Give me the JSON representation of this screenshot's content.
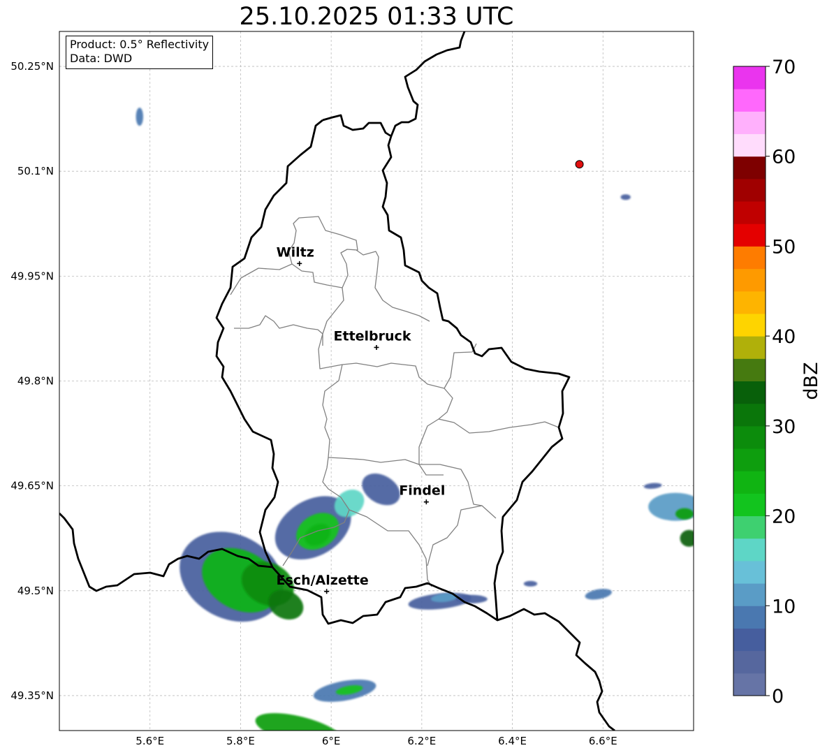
{
  "title": "25.10.2025 01:33 UTC",
  "info": {
    "product": "Product: 0.5° Reflectivity",
    "source": "Data: DWD"
  },
  "map": {
    "lon_range": [
      5.4,
      6.8
    ],
    "lat_range": [
      49.3,
      50.3
    ],
    "lat_ticks": [
      {
        "value": 50.25,
        "label": "50.25°N"
      },
      {
        "value": 50.1,
        "label": "50.1°N"
      },
      {
        "value": 49.95,
        "label": "49.95°N"
      },
      {
        "value": 49.8,
        "label": "49.8°N"
      },
      {
        "value": 49.65,
        "label": "49.65°N"
      },
      {
        "value": 49.5,
        "label": "49.5°N"
      },
      {
        "value": 49.35,
        "label": "49.35°N"
      }
    ],
    "lon_ticks": [
      {
        "value": 5.6,
        "label": "5.6°E"
      },
      {
        "value": 5.8,
        "label": "5.8°E"
      },
      {
        "value": 6.0,
        "label": "6°E"
      },
      {
        "value": 6.2,
        "label": "6.2°E"
      },
      {
        "value": 6.4,
        "label": "6.4°E"
      },
      {
        "value": 6.6,
        "label": "6.6°E"
      }
    ],
    "cities": [
      {
        "name": "Wiltz",
        "lon": 5.93,
        "lat": 49.968
      },
      {
        "name": "Ettelbruck",
        "lon": 6.1,
        "lat": 49.848
      },
      {
        "name": "Findel",
        "lon": 6.21,
        "lat": 49.627
      },
      {
        "name": "Esch/Alzette",
        "lon": 5.99,
        "lat": 49.499
      }
    ],
    "radar_site": {
      "lon": 6.548,
      "lat": 50.11,
      "color": "#e11010"
    },
    "border_color": "#000000",
    "canton_color": "#808080",
    "grid": true
  },
  "colorbar": {
    "label": "dBZ",
    "min": 0,
    "max": 70,
    "step": 2.5,
    "ticks": [
      {
        "value": 0,
        "label": "0"
      },
      {
        "value": 10,
        "label": "10"
      },
      {
        "value": 20,
        "label": "20"
      },
      {
        "value": 30,
        "label": "30"
      },
      {
        "value": 40,
        "label": "40"
      },
      {
        "value": 50,
        "label": "50"
      },
      {
        "value": 60,
        "label": "60"
      },
      {
        "value": 70,
        "label": "70"
      }
    ],
    "colors": [
      "#6674a6",
      "#56679e",
      "#465e9e",
      "#4a78b0",
      "#5a9cc6",
      "#68c0d8",
      "#5ed6c6",
      "#3ed070",
      "#12c41e",
      "#10b412",
      "#0e9e0e",
      "#0c8c0c",
      "#0a760a",
      "#08600a",
      "#467a10",
      "#b0b00a",
      "#fed400",
      "#feb400",
      "#fe9a00",
      "#fe7c00",
      "#e40000",
      "#c00000",
      "#a00000",
      "#7e0000",
      "#ffdcfc",
      "#ffb0fc",
      "#ff68fc",
      "#ea34ee"
    ]
  },
  "radar_echoes": [
    {
      "lon": 5.78,
      "lat": 49.52,
      "rx": 0.12,
      "ry": 0.06,
      "rot": 28,
      "dbz": 6
    },
    {
      "lon": 5.8,
      "lat": 49.515,
      "rx": 0.09,
      "ry": 0.042,
      "rot": 28,
      "dbz": 24
    },
    {
      "lon": 5.86,
      "lat": 49.51,
      "rx": 0.06,
      "ry": 0.03,
      "rot": 25,
      "dbz": 29
    },
    {
      "lon": 5.9,
      "lat": 49.48,
      "rx": 0.04,
      "ry": 0.02,
      "rot": 25,
      "dbz": 31
    },
    {
      "lon": 5.96,
      "lat": 49.59,
      "rx": 0.09,
      "ry": 0.04,
      "rot": -30,
      "dbz": 7
    },
    {
      "lon": 5.97,
      "lat": 49.585,
      "rx": 0.05,
      "ry": 0.024,
      "rot": -30,
      "dbz": 20
    },
    {
      "lon": 5.97,
      "lat": 49.58,
      "rx": 0.03,
      "ry": 0.014,
      "rot": -30,
      "dbz": 24
    },
    {
      "lon": 6.11,
      "lat": 49.645,
      "rx": 0.045,
      "ry": 0.02,
      "rot": 30,
      "dbz": 5
    },
    {
      "lon": 6.04,
      "lat": 49.625,
      "rx": 0.035,
      "ry": 0.018,
      "rot": -35,
      "dbz": 16
    },
    {
      "lon": 6.24,
      "lat": 49.485,
      "rx": 0.07,
      "ry": 0.011,
      "rot": -6,
      "dbz": 5
    },
    {
      "lon": 6.25,
      "lat": 49.49,
      "rx": 0.03,
      "ry": 0.006,
      "rot": -6,
      "dbz": 12
    },
    {
      "lon": 6.03,
      "lat": 49.357,
      "rx": 0.07,
      "ry": 0.014,
      "rot": -10,
      "dbz": 8
    },
    {
      "lon": 6.04,
      "lat": 49.358,
      "rx": 0.03,
      "ry": 0.006,
      "rot": -10,
      "dbz": 20
    },
    {
      "lon": 5.93,
      "lat": 49.3,
      "rx": 0.1,
      "ry": 0.02,
      "rot": 14,
      "dbz": 26
    },
    {
      "lon": 6.76,
      "lat": 49.62,
      "rx": 0.06,
      "ry": 0.02,
      "rot": 0,
      "dbz": 10
    },
    {
      "lon": 6.78,
      "lat": 49.61,
      "rx": 0.02,
      "ry": 0.008,
      "rot": 0,
      "dbz": 25
    },
    {
      "lon": 6.79,
      "lat": 49.575,
      "rx": 0.02,
      "ry": 0.012,
      "rot": 0,
      "dbz": 33
    },
    {
      "lon": 5.577,
      "lat": 50.178,
      "rx": 0.008,
      "ry": 0.013,
      "rot": 0,
      "dbz": 8
    },
    {
      "lon": 6.65,
      "lat": 50.063,
      "rx": 0.011,
      "ry": 0.004,
      "rot": 0,
      "dbz": 6
    },
    {
      "lon": 6.59,
      "lat": 49.495,
      "rx": 0.03,
      "ry": 0.007,
      "rot": -10,
      "dbz": 9
    },
    {
      "lon": 6.44,
      "lat": 49.51,
      "rx": 0.015,
      "ry": 0.004,
      "rot": 0,
      "dbz": 6
    },
    {
      "lon": 6.71,
      "lat": 49.65,
      "rx": 0.02,
      "ry": 0.004,
      "rot": -5,
      "dbz": 6
    },
    {
      "lon": 6.31,
      "lat": 49.488,
      "rx": 0.035,
      "ry": 0.006,
      "rot": 0,
      "dbz": 5
    }
  ]
}
